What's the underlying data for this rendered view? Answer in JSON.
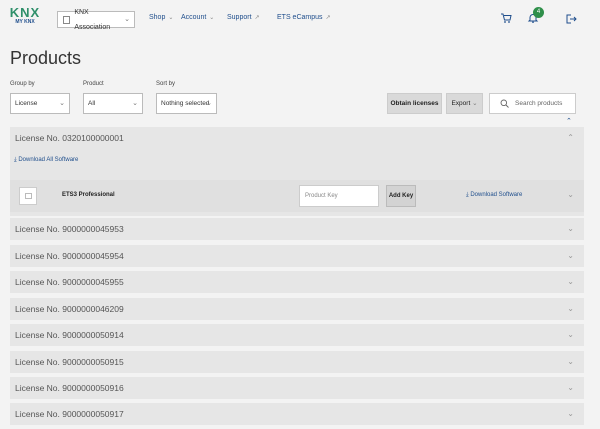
{
  "header": {
    "logo_top": "KNX",
    "logo_bottom": "MY KNX",
    "association": "KNX Association",
    "nav": {
      "shop": "Shop",
      "account": "Account",
      "support": "Support",
      "ecampus": "ETS eCampus"
    },
    "notification_count": "4"
  },
  "page": {
    "title": "Products"
  },
  "filters": {
    "group_by_label": "Group by",
    "group_by_value": "License",
    "product_label": "Product",
    "product_value": "All",
    "sort_by_label": "Sort by",
    "sort_by_value": "Nothing selected",
    "obtain_licenses": "Obtain licenses",
    "export": "Export",
    "search_placeholder": "Search products"
  },
  "licenses": [
    {
      "label": "License No. 0320100000001"
    },
    {
      "label": "License No. 9000000045953"
    },
    {
      "label": "License No. 9000000045954"
    },
    {
      "label": "License No. 9000000045955"
    },
    {
      "label": "License No. 9000000046209"
    },
    {
      "label": "License No. 9000000050914"
    },
    {
      "label": "License No. 9000000050915"
    },
    {
      "label": "License No. 9000000050916"
    },
    {
      "label": "License No. 9000000050917"
    }
  ],
  "expanded": {
    "download_all": "Download All Software",
    "product_name": "ETS3 Professional",
    "product_key_placeholder": "Product Key",
    "add_key": "Add Key",
    "download_software": "Download Software"
  }
}
